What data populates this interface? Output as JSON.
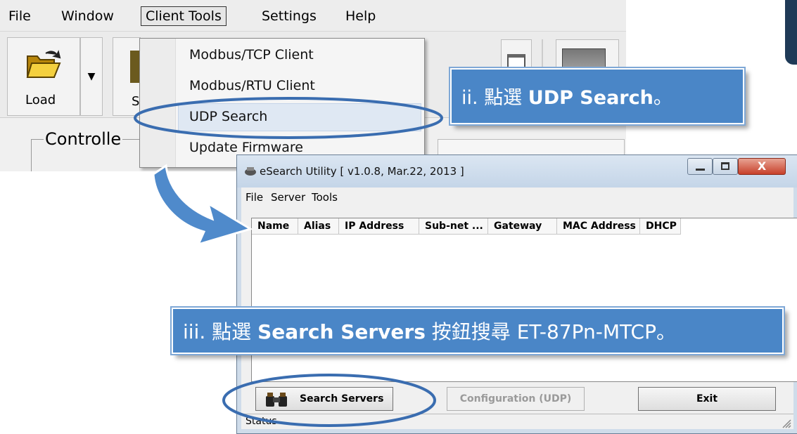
{
  "app": {
    "menu": [
      "File",
      "Window",
      "Client Tools",
      "Settings",
      "Help"
    ],
    "toolbar": {
      "load_label": "Load",
      "save_label_partial": "S"
    },
    "controller_label": "Controlle",
    "dropdown": [
      "Modbus/TCP Client",
      "Modbus/RTU Client",
      "UDP Search",
      "Update Firmware"
    ],
    "highlighted_item": "UDP Search"
  },
  "callouts": {
    "ii": {
      "prefix": "ii.",
      "pre": "點選 ",
      "bold": "UDP Search",
      "post": "。"
    },
    "iii": {
      "prefix": "iii.",
      "pre": "點選 ",
      "bold": "Search Servers",
      "post": " 按鈕搜尋 ET-87Pn-MTCP。"
    }
  },
  "dialog": {
    "title": "eSearch Utility [ v1.0.8, Mar.22, 2013 ]",
    "menu": [
      "File",
      "Server",
      "Tools"
    ],
    "columns": [
      "Name",
      "Alias",
      "IP Address",
      "Sub-net ...",
      "Gateway",
      "MAC Address",
      "DHCP"
    ],
    "buttons": {
      "search": "Search Servers",
      "config": "Configuration (UDP)",
      "exit": "Exit",
      "close": "X"
    },
    "status": "Status"
  },
  "colors": {
    "callout_bg": "#4a86c7",
    "ellipse_stroke": "#3a6db0",
    "arrow_fill": "#4f8acb"
  }
}
